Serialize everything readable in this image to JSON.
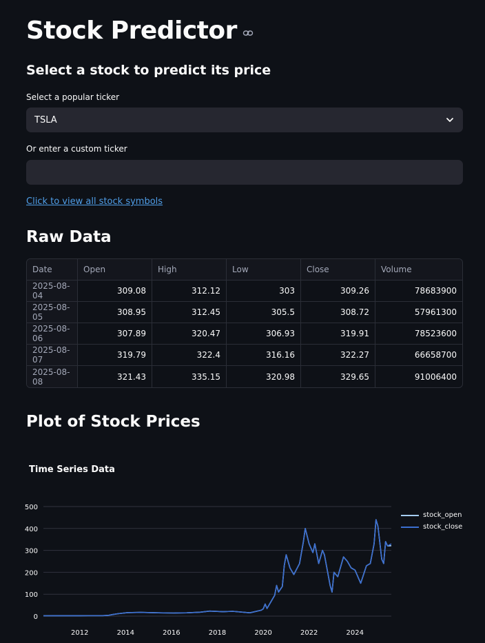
{
  "header": {
    "title": "Stock Predictor",
    "subtitle": "Select a stock to predict its price"
  },
  "form": {
    "popular_label": "Select a popular ticker",
    "popular_value": "TSLA",
    "custom_label": "Or enter a custom ticker",
    "custom_value": "",
    "custom_placeholder": "",
    "symbols_link": "Click to view all stock symbols"
  },
  "raw_data": {
    "heading": "Raw Data",
    "columns": [
      "Date",
      "Open",
      "High",
      "Low",
      "Close",
      "Volume"
    ],
    "rows": [
      [
        "2025-08-04",
        "309.08",
        "312.12",
        "303",
        "309.26",
        "78683900"
      ],
      [
        "2025-08-05",
        "308.95",
        "312.45",
        "305.5",
        "308.72",
        "57961300"
      ],
      [
        "2025-08-06",
        "307.89",
        "320.47",
        "306.93",
        "319.91",
        "78523600"
      ],
      [
        "2025-08-07",
        "319.79",
        "322.4",
        "316.16",
        "322.27",
        "66658700"
      ],
      [
        "2025-08-08",
        "321.43",
        "335.15",
        "320.98",
        "329.65",
        "91006400"
      ]
    ]
  },
  "plot": {
    "heading": "Plot of Stock Prices"
  },
  "colors": {
    "background": "#0e1117",
    "input_bg": "#262730",
    "link": "#4f9ee8",
    "open_series": "#a6cef5",
    "close_series": "#3b6fd1"
  },
  "chart_data": {
    "type": "line",
    "title": "Time Series Data",
    "xlabel": "",
    "ylabel": "",
    "x_ticks": [
      "2012",
      "2014",
      "2016",
      "2018",
      "2020",
      "2022",
      "2024"
    ],
    "y_ticks": [
      0,
      100,
      200,
      300,
      400,
      500
    ],
    "ylim": [
      0,
      500
    ],
    "xlim": [
      "2010-06",
      "2025-08"
    ],
    "grid": true,
    "legend_position": "top-right",
    "x": [
      "2010-06",
      "2011-01",
      "2012-01",
      "2013-01",
      "2013-04",
      "2013-06",
      "2013-09",
      "2014-02",
      "2014-09",
      "2015-06",
      "2016-02",
      "2016-09",
      "2017-04",
      "2017-09",
      "2018-04",
      "2018-09",
      "2019-06",
      "2019-12",
      "2020-01",
      "2020-02",
      "2020-03",
      "2020-07",
      "2020-08",
      "2020-09",
      "2020-11",
      "2020-12",
      "2021-01",
      "2021-03",
      "2021-05",
      "2021-08",
      "2021-10",
      "2021-11",
      "2022-01",
      "2022-03",
      "2022-04",
      "2022-06",
      "2022-08",
      "2022-09",
      "2022-12",
      "2023-01",
      "2023-02",
      "2023-04",
      "2023-07",
      "2023-09",
      "2023-11",
      "2024-01",
      "2024-03",
      "2024-04",
      "2024-07",
      "2024-09",
      "2024-11",
      "2024-12",
      "2025-01",
      "2025-03",
      "2025-04",
      "2025-05",
      "2025-06",
      "2025-08"
    ],
    "series": [
      {
        "name": "stock_open",
        "values": [
          1.5,
          1.8,
          1.9,
          2.3,
          3.5,
          7,
          11,
          16,
          17,
          15,
          14,
          15,
          18,
          23,
          20,
          22,
          15,
          27,
          33,
          55,
          35,
          95,
          140,
          110,
          135,
          230,
          280,
          220,
          190,
          240,
          340,
          400,
          330,
          290,
          330,
          240,
          300,
          280,
          140,
          110,
          200,
          180,
          270,
          250,
          220,
          210,
          170,
          150,
          230,
          240,
          330,
          440,
          410,
          260,
          240,
          340,
          320,
          321.43
        ]
      },
      {
        "name": "stock_close",
        "values": [
          1.5,
          1.8,
          1.9,
          2.3,
          3.5,
          7,
          11,
          16,
          17,
          15,
          14,
          15,
          18,
          23,
          20,
          22,
          15,
          27,
          33,
          55,
          35,
          95,
          140,
          110,
          135,
          230,
          280,
          220,
          190,
          240,
          340,
          400,
          330,
          290,
          330,
          240,
          300,
          280,
          140,
          110,
          200,
          180,
          270,
          250,
          220,
          210,
          170,
          150,
          230,
          240,
          330,
          440,
          410,
          260,
          240,
          340,
          320,
          329.65
        ]
      }
    ]
  }
}
